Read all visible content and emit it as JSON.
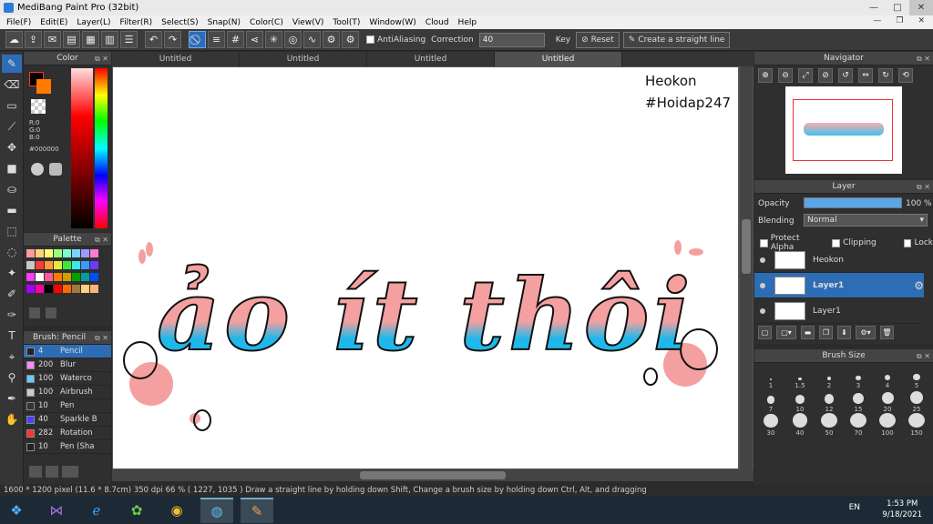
{
  "titlebar": {
    "title": "MediBang Paint Pro (32bit)"
  },
  "menu": [
    "File(F)",
    "Edit(E)",
    "Layer(L)",
    "Filter(R)",
    "Select(S)",
    "Snap(N)",
    "Color(C)",
    "View(V)",
    "Tool(T)",
    "Window(W)",
    "Cloud",
    "Help"
  ],
  "toolbar": {
    "antialiasing_label": "AntiAliasing",
    "correction_label": "Correction",
    "correction_value": "40",
    "key_label": "Key",
    "reset_label": "Reset",
    "straight_line_label": "Create a straight line"
  },
  "color_panel": {
    "title": "Color",
    "r": "R:0",
    "g": "G:0",
    "b": "B:0",
    "hex": "#000000",
    "primary_color": "#000000",
    "secondary_color": "#ff7a00"
  },
  "palette_panel": {
    "title": "Palette",
    "swatches": [
      "#ff9a9a",
      "#ffd27a",
      "#ffff7a",
      "#9aff7a",
      "#7affd2",
      "#7ad2ff",
      "#9a9aff",
      "#ff7ad2",
      "#c8c8c8",
      "#ff3a3a",
      "#ff9a3a",
      "#e8e83a",
      "#3ae83a",
      "#3ae8e8",
      "#3a9aff",
      "#6a3aff",
      "#ff3aff",
      "#ffffff",
      "#ff5a9a",
      "#ff7a00",
      "#c8a000",
      "#00a000",
      "#00a0a0",
      "#0050ff",
      "#a000ff",
      "#ff00a0",
      "#000000",
      "#ff0000",
      "#ff6a00",
      "#a07a3a",
      "#ffd27a",
      "#ffb27a"
    ]
  },
  "brush_panel": {
    "title": "Brush: Pencil",
    "brushes": [
      {
        "size": "4",
        "name": "Pencil",
        "color": "#222222"
      },
      {
        "size": "200",
        "name": "Blur",
        "color": "#ff88ff"
      },
      {
        "size": "100",
        "name": "Waterco",
        "color": "#66ccff"
      },
      {
        "size": "100",
        "name": "Airbrush",
        "color": "#cccccc"
      },
      {
        "size": "10",
        "name": "Pen",
        "color": "#333333"
      },
      {
        "size": "40",
        "name": "Sparkle B",
        "color": "#4444ff"
      },
      {
        "size": "282",
        "name": "Rotation",
        "color": "#ff3333"
      },
      {
        "size": "10",
        "name": "Pen (Sha",
        "color": "#222222"
      }
    ]
  },
  "tabs": [
    "Untitled",
    "Untitled",
    "Untitled",
    "Untitled"
  ],
  "canvas": {
    "watermark_line1": "Heokon",
    "watermark_line2": "#Hoidap247",
    "artwork_text": "ảo ít thôi",
    "pink": "#f5a0a0",
    "blue": "#1eb8ea"
  },
  "navigator": {
    "title": "Navigator"
  },
  "layer_panel": {
    "title": "Layer",
    "opacity_label": "Opacity",
    "opacity_value": "100 %",
    "opacity_level": 1.0,
    "blending_label": "Blending",
    "blending_value": "Normal",
    "protect_alpha": "Protect Alpha",
    "clipping": "Clipping",
    "lock": "Lock",
    "layers": [
      "Heokon",
      "Layer1",
      "Layer1"
    ]
  },
  "brush_size_panel": {
    "title": "Brush Size",
    "sizes": [
      "1",
      "1.5",
      "2",
      "3",
      "4",
      "5",
      "7",
      "10",
      "12",
      "15",
      "20",
      "25",
      "30",
      "40",
      "50",
      "70",
      "100",
      "150"
    ]
  },
  "statusbar": {
    "text": "1600 * 1200 pixel   (11.6 * 8.7cm)   350 dpi   66 %   ( 1227, 1035 )   Draw a straight line by holding down Shift, Change a brush size by holding down Ctrl, Alt, and dragging"
  },
  "taskbar": {
    "lang": "EN",
    "time": "1:53 PM",
    "date": "9/18/2021"
  }
}
